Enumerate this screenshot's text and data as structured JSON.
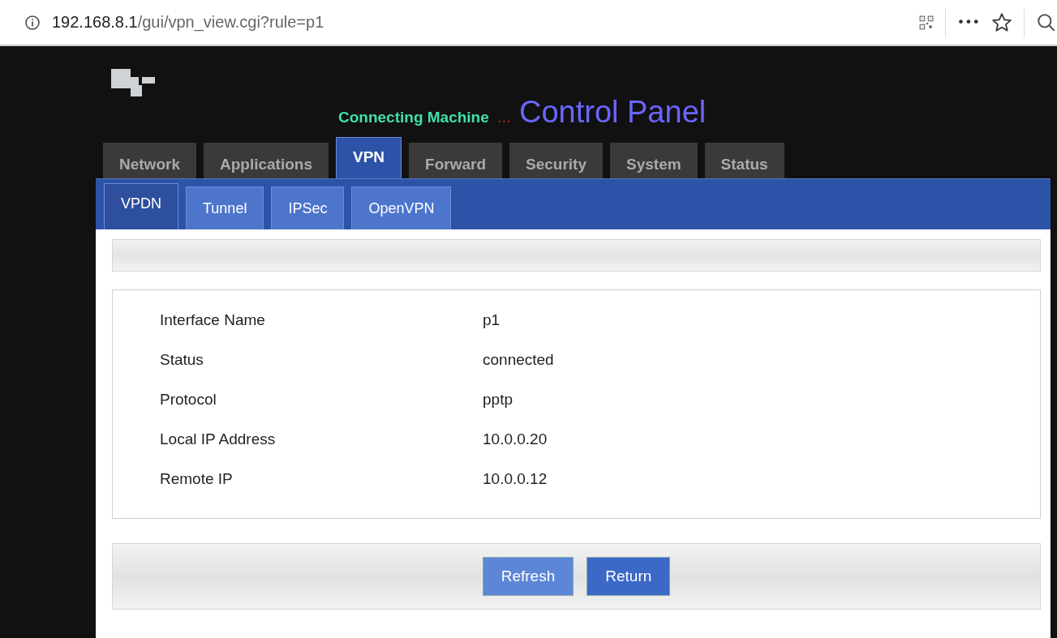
{
  "browser": {
    "url_host": "192.168.8.1",
    "url_path": "/gui/vpn_view.cgi?rule=p1",
    "more": "•••"
  },
  "header": {
    "subtitle": "Connecting Machine",
    "dots": "...",
    "title": "Control Panel"
  },
  "tabs": [
    {
      "label": "Network",
      "selected": false
    },
    {
      "label": "Applications",
      "selected": false
    },
    {
      "label": "VPN",
      "selected": true
    },
    {
      "label": "Forward",
      "selected": false
    },
    {
      "label": "Security",
      "selected": false
    },
    {
      "label": "System",
      "selected": false
    },
    {
      "label": "Status",
      "selected": false
    }
  ],
  "subtabs": [
    {
      "label": "VPDN",
      "selected": true
    },
    {
      "label": "Tunnel",
      "selected": false
    },
    {
      "label": "IPSec",
      "selected": false
    },
    {
      "label": "OpenVPN",
      "selected": false
    }
  ],
  "details": [
    {
      "label": "Interface Name",
      "value": "p1"
    },
    {
      "label": "Status",
      "value": "connected"
    },
    {
      "label": "Protocol",
      "value": "pptp"
    },
    {
      "label": "Local IP Address",
      "value": "10.0.0.20"
    },
    {
      "label": "Remote IP",
      "value": "10.0.0.12"
    }
  ],
  "buttons": [
    "Refresh",
    "Return"
  ]
}
